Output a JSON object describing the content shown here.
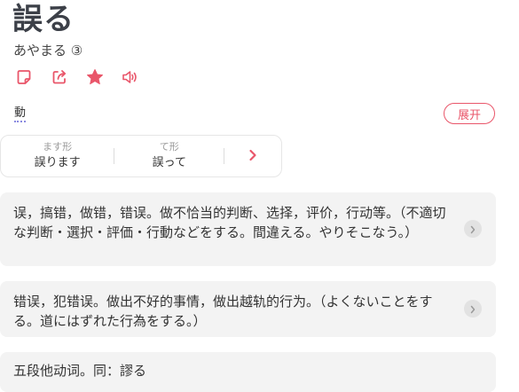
{
  "entry": {
    "word": "誤る",
    "reading": "あやまる",
    "accent": "③",
    "pos": "動"
  },
  "actions": [
    {
      "name": "note",
      "icon": "note-icon"
    },
    {
      "name": "share",
      "icon": "share-icon"
    },
    {
      "name": "favorite",
      "icon": "star-icon"
    },
    {
      "name": "audio",
      "icon": "speaker-icon"
    }
  ],
  "expand_label": "展开",
  "conjugations": [
    {
      "label": "ます形",
      "value": "誤ります"
    },
    {
      "label": "て形",
      "value": "誤って"
    }
  ],
  "definitions": [
    {
      "text": "误，搞错，做错，错误。做不恰当的判断、选择，评价，行动等。（不適切な判断・選択・評価・行動などをする。間違える。やりそこなう。）"
    },
    {
      "text": "错误，犯错误。做出不好的事情，做出越轨的行为。（よくないことをする。道にはずれた行為をする。）"
    },
    {
      "text": "五段他动词。同：謬る"
    }
  ],
  "colors": {
    "accent": "#e9566a",
    "card_bg": "#f3f3f3",
    "title": "#3c4048"
  }
}
